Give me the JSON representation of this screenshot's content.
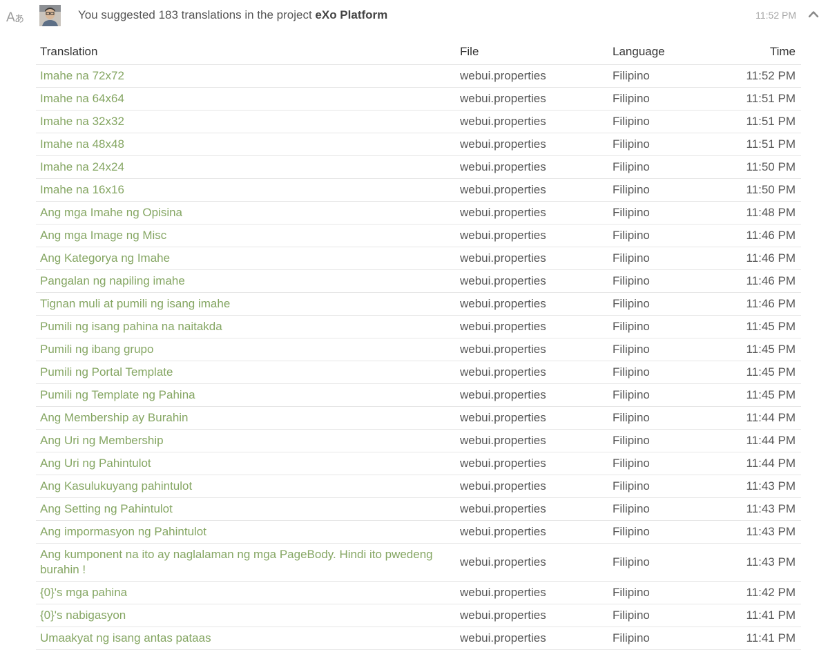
{
  "header": {
    "summary_prefix": "You suggested 183 translations in the project",
    "project_name": "eXo Platform",
    "time": "11:52 PM"
  },
  "colors": {
    "link": "#85a663",
    "text": "#555555",
    "muted": "#a6a6a6",
    "divider": "#e6e6e6"
  },
  "icons": {
    "left": "translate-icon",
    "user": "avatar",
    "right": "chevron-up-icon"
  },
  "table": {
    "headers": {
      "translation": "Translation",
      "file": "File",
      "language": "Language",
      "time": "Time"
    },
    "rows": [
      {
        "translation": "Imahe na 72x72",
        "file": "webui.properties",
        "language": "Filipino",
        "time": "11:52 PM"
      },
      {
        "translation": "Imahe na 64x64",
        "file": "webui.properties",
        "language": "Filipino",
        "time": "11:51 PM"
      },
      {
        "translation": "Imahe na 32x32",
        "file": "webui.properties",
        "language": "Filipino",
        "time": "11:51 PM"
      },
      {
        "translation": "Imahe na 48x48",
        "file": "webui.properties",
        "language": "Filipino",
        "time": "11:51 PM"
      },
      {
        "translation": "Imahe na 24x24",
        "file": "webui.properties",
        "language": "Filipino",
        "time": "11:50 PM"
      },
      {
        "translation": "Imahe na 16x16",
        "file": "webui.properties",
        "language": "Filipino",
        "time": "11:50 PM"
      },
      {
        "translation": "Ang mga Imahe ng Opisina",
        "file": "webui.properties",
        "language": "Filipino",
        "time": "11:48 PM"
      },
      {
        "translation": "Ang mga Image ng Misc",
        "file": "webui.properties",
        "language": "Filipino",
        "time": "11:46 PM"
      },
      {
        "translation": "Ang Kategorya ng Imahe",
        "file": "webui.properties",
        "language": "Filipino",
        "time": "11:46 PM"
      },
      {
        "translation": "Pangalan ng napiling imahe",
        "file": "webui.properties",
        "language": "Filipino",
        "time": "11:46 PM"
      },
      {
        "translation": "Tignan muli at pumili ng isang imahe",
        "file": "webui.properties",
        "language": "Filipino",
        "time": "11:46 PM"
      },
      {
        "translation": "Pumili ng isang pahina na naitakda",
        "file": "webui.properties",
        "language": "Filipino",
        "time": "11:45 PM"
      },
      {
        "translation": "Pumili ng ibang grupo",
        "file": "webui.properties",
        "language": "Filipino",
        "time": "11:45 PM"
      },
      {
        "translation": "Pumili ng Portal Template",
        "file": "webui.properties",
        "language": "Filipino",
        "time": "11:45 PM"
      },
      {
        "translation": "Pumili ng Template ng Pahina",
        "file": "webui.properties",
        "language": "Filipino",
        "time": "11:45 PM"
      },
      {
        "translation": "Ang Membership ay Burahin",
        "file": "webui.properties",
        "language": "Filipino",
        "time": "11:44 PM"
      },
      {
        "translation": "Ang Uri ng Membership",
        "file": "webui.properties",
        "language": "Filipino",
        "time": "11:44 PM"
      },
      {
        "translation": "Ang Uri ng Pahintulot",
        "file": "webui.properties",
        "language": "Filipino",
        "time": "11:44 PM"
      },
      {
        "translation": "Ang Kasulukuyang pahintulot",
        "file": "webui.properties",
        "language": "Filipino",
        "time": "11:43 PM"
      },
      {
        "translation": "Ang Setting ng Pahintulot",
        "file": "webui.properties",
        "language": "Filipino",
        "time": "11:43 PM"
      },
      {
        "translation": "Ang impormasyon ng Pahintulot",
        "file": "webui.properties",
        "language": "Filipino",
        "time": "11:43 PM"
      },
      {
        "translation": "Ang kumponent na ito ay naglalaman ng mga PageBody. Hindi ito pwedeng burahin !",
        "file": "webui.properties",
        "language": "Filipino",
        "time": "11:43 PM"
      },
      {
        "translation": "{0}'s mga pahina",
        "file": "webui.properties",
        "language": "Filipino",
        "time": "11:42 PM"
      },
      {
        "translation": "{0}'s nabigasyon",
        "file": "webui.properties",
        "language": "Filipino",
        "time": "11:41 PM"
      },
      {
        "translation": "Umaakyat ng isang antas pataas",
        "file": "webui.properties",
        "language": "Filipino",
        "time": "11:41 PM"
      }
    ]
  }
}
